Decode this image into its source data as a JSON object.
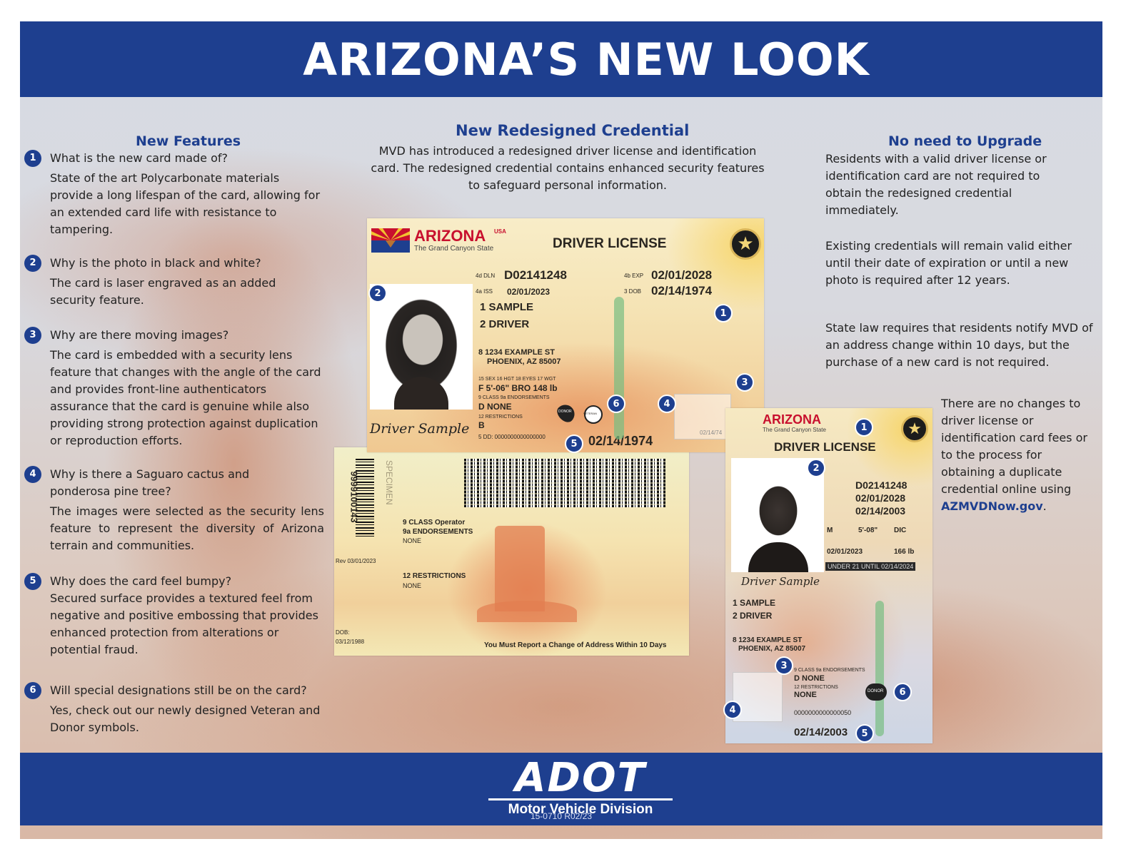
{
  "header": {
    "title": "ARIZONA’S NEW LOOK"
  },
  "left": {
    "title": "New Features",
    "faqs": [
      {
        "num": "1",
        "q": "What is the new card made of?",
        "a": "State of the art Polycarbonate materials provide a long lifespan of the card, allowing for an extended card life with resistance to tampering."
      },
      {
        "num": "2",
        "q": "Why is the photo in black and white?",
        "a": "The card is laser engraved as an added security feature."
      },
      {
        "num": "3",
        "q": "Why are there moving images?",
        "a": "The card is embedded with a security lens feature that changes with the angle of the card and provides front-line authenticators assurance that the card is genuine while also providing strong protection against duplication or reproduction efforts."
      },
      {
        "num": "4",
        "q": "Why is there a Saguaro cactus and ponderosa pine tree?",
        "a": "The images were selected as the security lens feature to represent the diversity of Arizona terrain and communities."
      },
      {
        "num": "5",
        "q": "Why does the card feel bumpy?",
        "a": "Secured surface provides a textured feel from negative and positive embossing that provides enhanced protection from alterations or potential fraud."
      },
      {
        "num": "6",
        "q": "Will special designations still be on the card?",
        "a": "Yes, check out our newly designed Veteran and Donor symbols."
      }
    ]
  },
  "center": {
    "title": "New Redesigned Credential",
    "intro": "MVD has introduced a redesigned driver license and identification card. The redesigned credential contains enhanced security features to safeguard personal information."
  },
  "card_front": {
    "state": "ARIZONA",
    "usa": "USA",
    "tagline": "The Grand Canyon State",
    "type": "DRIVER LICENSE",
    "dln_label": "4d DLN",
    "dln": "D02141248",
    "exp_label": "4b EXP",
    "exp": "02/01/2028",
    "iss_label": "4a ISS",
    "iss": "02/01/2023",
    "dob_label": "3 DOB",
    "dob": "02/14/1974",
    "last": "1 SAMPLE",
    "first": "2 DRIVER",
    "addr1": "8 1234 EXAMPLE ST",
    "addr2": "PHOENIX, AZ 85007",
    "phys_labels": "15 SEX   16 HGT   18 EYES   17 WGT",
    "phys_values": "F    5'-06\"  BRO    148 lb",
    "class_line": "9 CLASS  9a ENDORSEMENTS",
    "class_vals": "D        NONE",
    "restr": "12 RESTRICTIONS",
    "restr_val": "B",
    "dd": "5 DD: 0000000000000000",
    "dob_small": "02/14/1974",
    "signature": "Driver Sample",
    "donor": "DONOR",
    "veteran": "VETERAN",
    "ghost_dob": "02/14/74"
  },
  "card_back": {
    "barcode_num": "9999100143",
    "specimen": "SPECIMEN",
    "class": "9 CLASS Operator",
    "endorse": "9a ENDORSEMENTS",
    "endorse_val": "NONE",
    "restr": "12 RESTRICTIONS",
    "restr_val": "NONE",
    "rev": "Rev 03/01/2023",
    "dob_label": "DOB:",
    "dob": "03/12/1988",
    "notice": "You Must Report a Change of Address Within 10 Days"
  },
  "card_vert": {
    "state": "ARIZONA",
    "tagline": "The Grand Canyon State",
    "type": "DRIVER LICENSE",
    "dln": "D02141248",
    "exp": "02/01/2028",
    "dob": "02/14/2003",
    "sex": "M",
    "hgt": "5'-08\"",
    "eyes": "DIC",
    "iss": "02/01/2023",
    "wgt": "166 lb",
    "under21": "UNDER 21 UNTIL 02/14/2024",
    "signature": "Driver Sample",
    "last": "1 SAMPLE",
    "first": "2 DRIVER",
    "addr1": "8 1234 EXAMPLE ST",
    "addr2": "PHOENIX, AZ 85007",
    "class_line": "9 CLASS   9a ENDORSEMENTS",
    "class_vals": "D          NONE",
    "restr": "12 RESTRICTIONS",
    "restr_val": "NONE",
    "dd": "0000000000000050",
    "dob_small": "02/14/2003",
    "donor": "DONOR"
  },
  "right": {
    "title": "No need to Upgrade",
    "p1": "Residents with a valid driver license or identification card are not required to obtain the redesigned credential immediately.",
    "p2": "Existing credentials will remain valid either until their date of expiration or until a new photo is required after 12 years.",
    "p3": "State law requires that residents notify MVD of an address change within 10 days, but the purchase of a new card is not required.",
    "p4": "There are no changes to driver license or identification card fees or to the process for obtaining a duplicate credential online using",
    "link": "AZMVDNow.gov",
    "link_suffix": "."
  },
  "footer": {
    "logo": "ADOT",
    "division": "Motor Vehicle Division",
    "code": "15-0710 R02/23"
  },
  "badges": [
    "1",
    "2",
    "3",
    "4",
    "5",
    "6"
  ],
  "colors": {
    "brand_blue": "#1e3f8f",
    "link_blue": "#1e3f8f"
  }
}
